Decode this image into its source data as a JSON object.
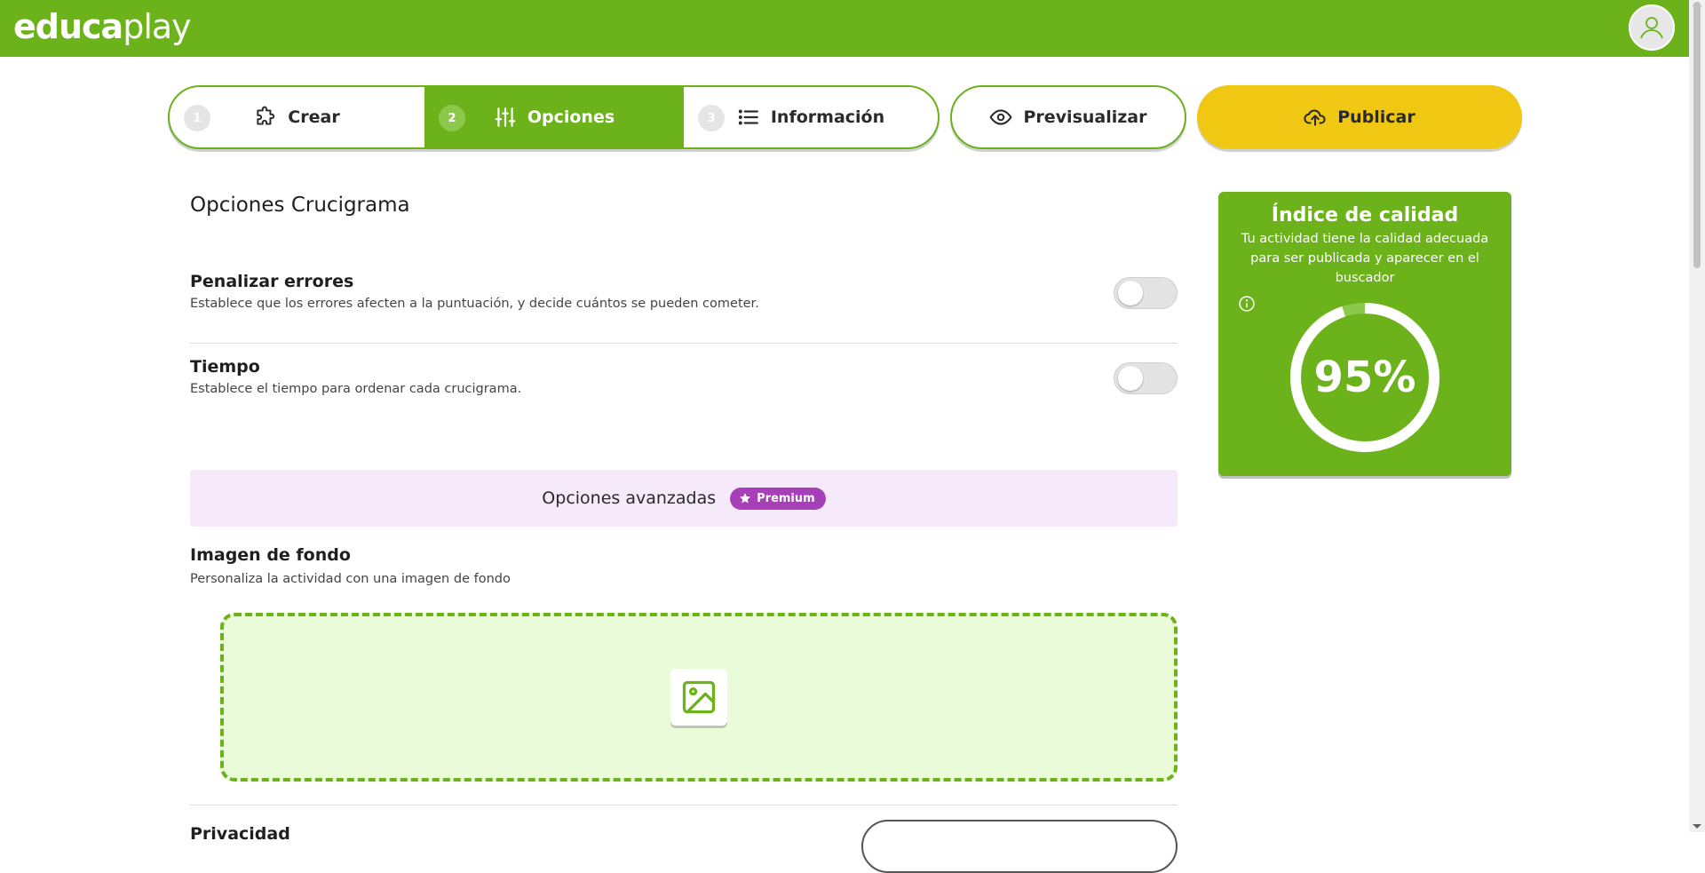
{
  "header": {
    "logo_bold": "educa",
    "logo_light": "play",
    "avatar_icon": "user-icon"
  },
  "steps": [
    {
      "number": "1",
      "label": "Crear",
      "icon": "puzzle-icon",
      "active": false
    },
    {
      "number": "2",
      "label": "Opciones",
      "icon": "sliders-icon",
      "active": true
    },
    {
      "number": "3",
      "label": "Información",
      "icon": "list-icon",
      "active": false
    }
  ],
  "actions": {
    "preview_label": "Previsualizar",
    "preview_icon": "eye-icon",
    "publish_label": "Publicar",
    "publish_icon": "upload-cloud-icon"
  },
  "page_title": "Opciones Crucigrama",
  "options": [
    {
      "title": "Penalizar errores",
      "description": "Establece que los errores afecten a la puntuación, y decide cuántos se pueden cometer.",
      "enabled": false
    },
    {
      "title": "Tiempo",
      "description": "Establece el tiempo para ordenar cada crucigrama.",
      "enabled": false
    }
  ],
  "advanced": {
    "label": "Opciones avanzadas",
    "badge": "Premium"
  },
  "background_image": {
    "title": "Imagen de fondo",
    "description": "Personaliza la actividad con una imagen de fondo",
    "icon": "image-icon"
  },
  "privacy": {
    "title": "Privacidad"
  },
  "quality": {
    "title": "Índice de calidad",
    "description": "Tu actividad tiene la calidad adecuada para ser publicada y aparecer en el buscador",
    "percent_label": "95%",
    "percent": 95
  },
  "colors": {
    "brand_green": "#6cb21a",
    "publish_yellow": "#f0c712",
    "premium_purple": "#a63fb8",
    "advanced_bg": "#f5e9fa",
    "dropzone_bg": "#eafbd9"
  }
}
